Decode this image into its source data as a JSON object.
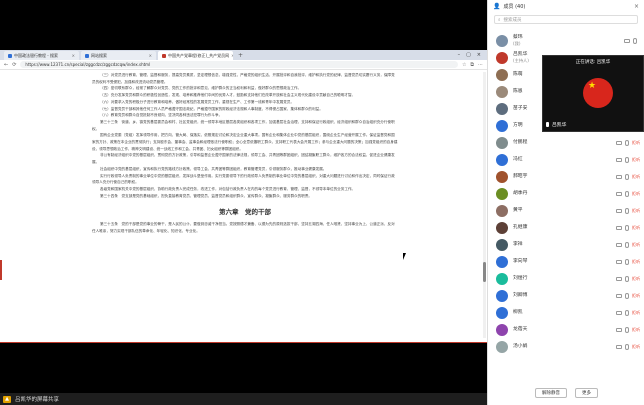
{
  "browser": {
    "tabs": [
      {
        "label": "中国政法银行教程 - 搜索",
        "color": "#2f6fd6"
      },
      {
        "label": "网站搜索",
        "color": "#2f6fd6"
      },
      {
        "label": "中国共产党章程(修正)_共产党员网",
        "color": "#c0392b"
      }
    ],
    "url": "https://www.12371.cn/special/zggcdzc/zggcdzcqw/index.shtml",
    "chapter_title": "第六章　党的干部",
    "paragraphs": [
      "（三）对党员进行教育、管理、监督和服务，提高党员素质，坚定理想信念，增强党性，严格党的组织生活，开展批评和自我批评，维护和执行党的纪律，监督党员切实履行义务，保障党员的权利不受侵犯。加强和改进流动党员管理。",
      "（四）密切联系群众，经常了解群众对党员、党的工作的批评和意见，维护群众的正当权利和利益，做好群众的思想政治工作。",
      "（五）充分发挥党员和群众的积极性创造性，发现、培养和推荐他们中间的优秀人才，鼓励和支持他们在改革开放和社会主义现代化建设中贡献自己的聪明才智。",
      "（六）对要求入党的积极分子进行教育和培养，做好经常性的发展党员工作，重视在生产、工作第一线和青年中发展党员。",
      "（七）监督党员干部和其他任何工作人员严格遵守国法政纪，严格遵守国家的财政经济法规和人事制度，不得侵占国家、集体和群众的利益。",
      "（八）教育党员和群众自觉抵制不良倾向，坚决同各种违法犯罪行为作斗争。",
      "第三十三条　街道、乡、镇党的基层委员会和村、社区党组织，统一领导本地区基层各类组织和各项工作，加强基层社会治理，支持和保证行政组织、经济组织和群众自治组织充分行使职权。",
      "国有企业党委（党组）发挥领导作用，把方向、管大局、保落实，依照规定讨论和决定企业重大事项。国有企业和集体企业中党的基层组织，围绕企业生产经营开展工作。保证监督党和国家的方针、政策在本企业的贯彻执行；支持股东会、董事会、监事会和经理依法行使职权；全心全意依靠职工群众，支持职工代表大会开展工作；参与企业重大问题的决策；加强党组织的自身建设，领导思想政治工作、精神文明建设、统一战线工作和工会、共青团、妇女组织等群团组织。",
      "非公有制经济组织中党的基层组织，贯彻党的方针政策，引导和监督企业遵守国家的法律法规，领导工会、共青团等群团组织，团结凝聚职工群众，维护各方的合法权益，促进企业健康发展。",
      "社会组织中党的基层组织，宣传和执行党的路线方针政策，领导工会、共青团等群团组织，教育管理党员，引领服务群众，推动事业健康发展。",
      "实行行政领导人负责制的事业单位中党的基层组织，发挥战斗堡垒作用。实行党委领导下的行政领导人负责制的事业单位中党的基层组织，对重大问题进行讨论和作出决定，同时保证行政领导人充分行使自己的职权。",
      "各级党和国家机关中党的基层组织，协助行政负责人完成任务，改进工作，对包括行政负责人在内的每个党员进行教育、管理、监督，不领导本单位的业务工作。",
      "第三十四条　党支部是党的基础组织，担负直接教育党员、管理党员、监督党员和组织群众、宣传群众、凝聚群众、服务群众的职责。"
    ],
    "chapter_paragraph": "第三十五条　党的干部是党的事业的骨干，是人民的公仆，要做到忠诚干净担当。党按照德才兼备、以德为先的原则选拔干部，坚持五湖四海、任人唯贤，坚持事业为上、公道正派，反对任人唯亲，努力实现干部队伍的革命化、年轻化、知识化、专业化。"
  },
  "bottom_bar": {
    "label": "吕凯华的屏幕共享"
  },
  "panel": {
    "title": "成员 (40)",
    "search_placeholder": "搜索成员",
    "members": [
      {
        "name": "蔡玮",
        "sub": "(我)",
        "state": "",
        "color": "#7a8fa6"
      },
      {
        "name": "吕凯华",
        "sub": "(主持人)",
        "state": "",
        "color": "#c0392b"
      },
      {
        "name": "陈萌",
        "sub": "",
        "state": "",
        "color": "#8e6e53"
      },
      {
        "name": "陈恩",
        "sub": "",
        "state": "",
        "color": "#9b8a7a"
      },
      {
        "name": "苗子安",
        "sub": "",
        "state": "",
        "color": "#5d6d7e"
      },
      {
        "name": "方明",
        "sub": "",
        "state": "拒听",
        "color": "#2f6fd6"
      },
      {
        "name": "付鹏程",
        "sub": "",
        "state": "拒听",
        "color": "#7f8c8d"
      },
      {
        "name": "冯红",
        "sub": "",
        "state": "拒听",
        "color": "#2f6fd6"
      },
      {
        "name": "郝昭宇",
        "sub": "",
        "state": "拒听",
        "color": "#a0522d"
      },
      {
        "name": "胡季丹",
        "sub": "",
        "state": "拒听",
        "color": "#6b8e23"
      },
      {
        "name": "黄平",
        "sub": "",
        "state": "拒听",
        "color": "#8d6e63"
      },
      {
        "name": "孔继康",
        "sub": "",
        "state": "拒听",
        "color": "#5d4037"
      },
      {
        "name": "李祥",
        "sub": "",
        "state": "拒听",
        "color": "#455a64"
      },
      {
        "name": "李向琴",
        "sub": "",
        "state": "拒听",
        "color": "#2f6fd6"
      },
      {
        "name": "刘煜行",
        "sub": "",
        "state": "拒听",
        "color": "#1abc9c"
      },
      {
        "name": "刘卿博",
        "sub": "",
        "state": "拒听",
        "color": "#2f6fd6"
      },
      {
        "name": "柳凯",
        "sub": "",
        "state": "拒听",
        "color": "#2f6fd6"
      },
      {
        "name": "龙蓓天",
        "sub": "",
        "state": "拒听",
        "color": "#8e44ad"
      },
      {
        "name": "汤小娟",
        "sub": "",
        "state": "拒听",
        "color": "#95a5a6"
      }
    ],
    "mute_all_label": "解除静音",
    "more_label": "更多"
  },
  "video": {
    "talking_label": "正在讲话: 吕凯华",
    "name": "吕凯华"
  }
}
